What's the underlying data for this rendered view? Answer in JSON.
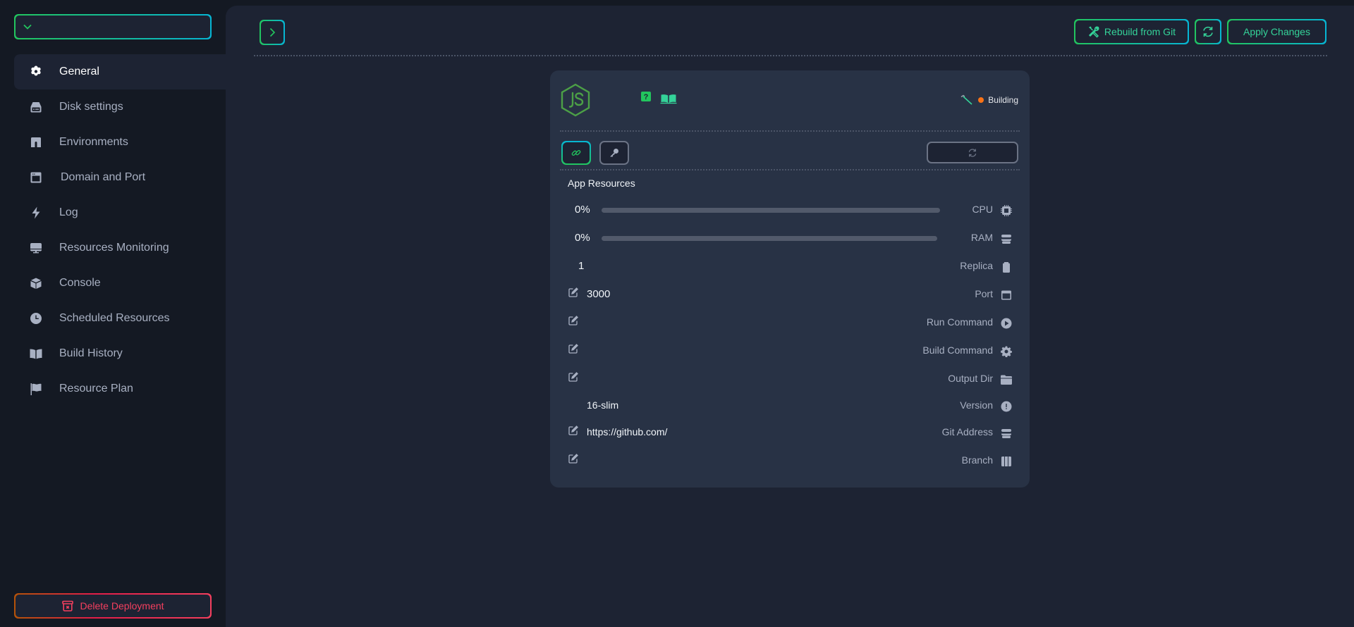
{
  "sidebar": {
    "project_select": {
      "value": ""
    },
    "items": [
      {
        "label": "General",
        "icon": "gear-flower-icon",
        "active": true
      },
      {
        "label": "Disk settings",
        "icon": "hard-drive-icon"
      },
      {
        "label": "Environments",
        "icon": "door-icon"
      },
      {
        "label": "Domain and Port",
        "icon": "browser-window-icon"
      },
      {
        "label": "Log",
        "icon": "bolt-icon"
      },
      {
        "label": "Resources Monitoring",
        "icon": "monitor-icon"
      },
      {
        "label": "Console",
        "icon": "cube-icon"
      },
      {
        "label": "Scheduled Resources",
        "icon": "clock-icon"
      },
      {
        "label": "Build History",
        "icon": "book-open-icon"
      },
      {
        "label": "Resource Plan",
        "icon": "flag-icon"
      }
    ],
    "delete_label": "Delete Deployment"
  },
  "toolbar": {
    "rebuild_label": "Rebuild from Git",
    "apply_label": "Apply Changes"
  },
  "card": {
    "runtime_logo": "nodejs",
    "status": {
      "label": "Building",
      "color": "#f97316"
    },
    "section_title": "App Resources",
    "resources": {
      "cpu": {
        "label": "CPU",
        "value": "0%",
        "percent": 0
      },
      "ram": {
        "label": "RAM",
        "value": "0%",
        "percent": 0
      },
      "replica": {
        "label": "Replica",
        "value": "1"
      },
      "port": {
        "label": "Port",
        "value": "3000"
      },
      "run_command": {
        "label": "Run Command",
        "value": ""
      },
      "build_command": {
        "label": "Build Command",
        "value": ""
      },
      "output_dir": {
        "label": "Output Dir",
        "value": ""
      },
      "version": {
        "label": "Version",
        "value": "16-slim"
      },
      "git_address": {
        "label": "Git Address",
        "value": "https://github.com/"
      },
      "branch": {
        "label": "Branch",
        "value": ""
      }
    }
  },
  "colors": {
    "accent_green": "#22c55e",
    "accent_cyan": "#06b6d4",
    "danger": "#f43f5e",
    "status_building": "#f97316"
  }
}
